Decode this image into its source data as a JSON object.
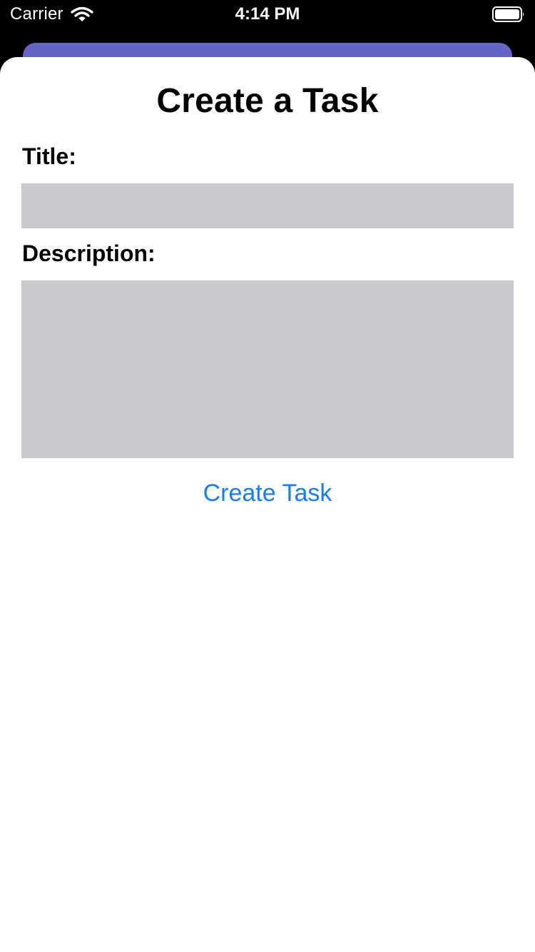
{
  "status_bar": {
    "carrier": "Carrier",
    "time": "4:14 PM",
    "icons": [
      "wifi-icon",
      "battery-icon"
    ]
  },
  "sheet": {
    "title": "Create a Task",
    "title_label": "Title:",
    "title_value": "",
    "description_label": "Description:",
    "description_value": "",
    "create_button_label": "Create Task"
  },
  "colors": {
    "background_sheet_behind": "#6565c4",
    "input_fill": "#c9c9cd",
    "button_text": "#1a7cf2",
    "status_bar_bg": "#000000"
  }
}
